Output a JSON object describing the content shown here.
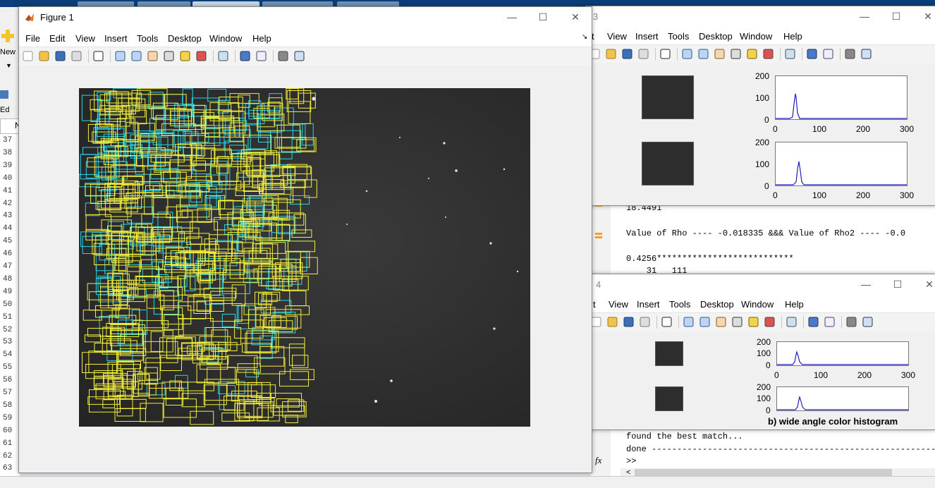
{
  "figure1": {
    "title": "Figure 1",
    "menus": [
      "File",
      "Edit",
      "View",
      "Insert",
      "Tools",
      "Desktop",
      "Window",
      "Help"
    ],
    "controls": {
      "minimize": "—",
      "maximize": "☐",
      "close": "✕"
    }
  },
  "figure3": {
    "title_fragment": "3",
    "menus": [
      "t",
      "View",
      "Insert",
      "Tools",
      "Desktop",
      "Window",
      "Help"
    ],
    "hist1_yticks": [
      "200",
      "100",
      "0"
    ],
    "hist1_xticks": [
      "0",
      "100",
      "200",
      "300"
    ],
    "hist2_yticks": [
      "200",
      "100",
      "0"
    ],
    "hist2_xticks": [
      "0",
      "100",
      "200",
      "300"
    ]
  },
  "figure4": {
    "title_fragment": "4",
    "menus": [
      "t",
      "View",
      "Insert",
      "Tools",
      "Desktop",
      "Window",
      "Help"
    ],
    "hist1_yticks": [
      "200",
      "100",
      "0"
    ],
    "hist1_xticks": [
      "0",
      "100",
      "200",
      "300"
    ],
    "hist2_yticks": [
      "200",
      "100",
      "0"
    ],
    "hist2_xticks": [
      "0",
      "100",
      "200",
      "300"
    ],
    "caption": "b) wide angle color histogram"
  },
  "desktop": {
    "new_label": "New",
    "editor_tab": "Ed",
    "tab_n": "N",
    "line_numbers": [
      "37",
      "38",
      "39",
      "40",
      "41",
      "42",
      "43",
      "44",
      "45",
      "46",
      "47",
      "48",
      "49",
      "50",
      "51",
      "52",
      "53",
      "54",
      "55",
      "56",
      "57",
      "58",
      "59",
      "60",
      "61",
      "62",
      "63"
    ]
  },
  "command_window": {
    "lines_top": [
      "18.4491",
      "Value of Rho ---- -0.018335 &&& Value of Rho2 ---- -0.0",
      "0.4256***************************",
      "    31   111"
    ],
    "lines_bottom": [
      "found the best match...",
      "done ----------------------------------------------------------------",
      "fx",
      ">>"
    ]
  }
}
